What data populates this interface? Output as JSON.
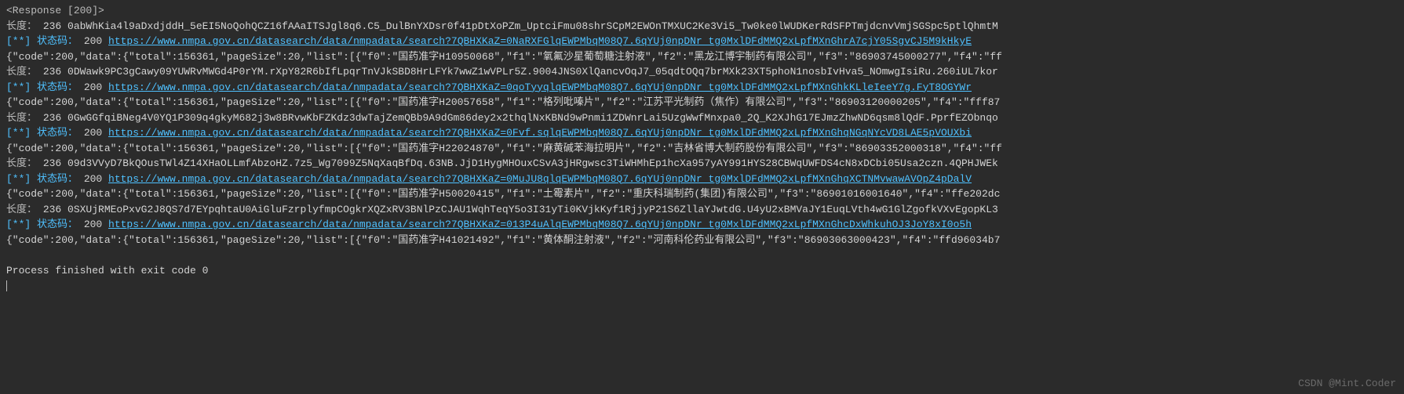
{
  "console": {
    "response_header": "<Response [200]>",
    "length_label": "长度：",
    "status_label": "[**] 状态码：",
    "status_code": "  200    ",
    "process_exit": "Process finished with exit code 0",
    "lines": [
      {
        "type": "length",
        "value": " 236 0abWhKia4l9aDxdjddH_5eEI5NoQohQCZ16fAAaITSJgl8q6.C5_DulBnYXDsr0f41pDtXoPZm_UptciFmu08shrSCpM2EWOnTMXUC2Ke3Vi5_Tw0ke0lWUDKerRdSFPTmjdcnvVmjSGSpc5ptlQhmtM"
      },
      {
        "type": "status",
        "url": "https://www.nmpa.gov.cn/datasearch/data/nmpadata/search?7QBHXKaZ=0NaRXFGlqEWPMbqM08Q7.6qYUj0npDNr_tg0MxlDFdMMQ2xLpfMXnGhrA7cjY05SgvCJ5M9kHkyE"
      },
      {
        "type": "json",
        "content": "{\"code\":200,\"data\":{\"total\":156361,\"pageSize\":20,\"list\":[{\"f0\":\"国药准字H10950068\",\"f1\":\"氧氟沙星葡萄糖注射液\",\"f2\":\"黑龙江博宇制药有限公司\",\"f3\":\"86903745000277\",\"f4\":\"ff"
      },
      {
        "type": "length",
        "value": " 236 0DWawk9PC3gCawy09YUWRvMWGd4P0rYM.rXpY82R6bIfLpqrTnVJkSBD8HrLFYk7wwZ1wVPLr5Z.9004JNS0XlQancvOqJ7_05qdtOQq7brMXk23XT5phoN1nosbIvHva5_NOmwgIsiRu.260iUL7kor"
      },
      {
        "type": "status",
        "url": "https://www.nmpa.gov.cn/datasearch/data/nmpadata/search?7QBHXKaZ=0qoTyyqlqEWPMbqM08Q7.6qYUj0npDNr_tg0MxlDFdMMQ2xLpfMXnGhkKLleIeeY7g.FyT8OGYWr"
      },
      {
        "type": "json",
        "content": "{\"code\":200,\"data\":{\"total\":156361,\"pageSize\":20,\"list\":[{\"f0\":\"国药准字H20057658\",\"f1\":\"格列吡嗪片\",\"f2\":\"江苏平光制药（焦作）有限公司\",\"f3\":\"86903120000205\",\"f4\":\"fff87"
      },
      {
        "type": "length",
        "value": " 236 0GwGGfqiBNeg4V0YQ1P309q4gkyM682j3w8BRvwKbFZKdz3dwTajZemQBb9A9dGm86dey2x2thqlNxKBNd9wPnmi1ZDWnrLai5UzgWwfMnxpa0_2Q_K2XJhG17EJmzZhwND6qsm8lQdF.PprfEZObnqo"
      },
      {
        "type": "status",
        "url": "https://www.nmpa.gov.cn/datasearch/data/nmpadata/search?7QBHXKaZ=0Fvf.sqlqEWPMbqM08Q7.6qYUj0npDNr_tg0MxlDFdMMQ2xLpfMXnGhqNGqNYcVD8LAE5pVOUXbi"
      },
      {
        "type": "json",
        "content": "{\"code\":200,\"data\":{\"total\":156361,\"pageSize\":20,\"list\":[{\"f0\":\"国药准字H22024870\",\"f1\":\"麻黄碱苯海拉明片\",\"f2\":\"吉林省博大制药股份有限公司\",\"f3\":\"86903352000318\",\"f4\":\"ff"
      },
      {
        "type": "length",
        "value": " 236 09d3VVyD7BkQOusTWl4Z14XHaOLLmfAbzoHZ.7z5_Wg7099Z5NqXaqBfDq.63NB.JjD1HygMHOuxCSvA3jHRgwsc3TiWHMhEp1hcXa957yAY991HYS28CBWqUWFDS4cN8xDCbi05Usa2czn.4QPHJWEk"
      },
      {
        "type": "status",
        "url": "https://www.nmpa.gov.cn/datasearch/data/nmpadata/search?7QBHXKaZ=0MuJU8qlqEWPMbqM08Q7.6qYUj0npDNr_tg0MxlDFdMMQ2xLpfMXnGhqXCTNMvwawAVOpZ4pDalV"
      },
      {
        "type": "json",
        "content": "{\"code\":200,\"data\":{\"total\":156361,\"pageSize\":20,\"list\":[{\"f0\":\"国药准字H50020415\",\"f1\":\"土霉素片\",\"f2\":\"重庆科瑞制药(集团)有限公司\",\"f3\":\"86901016001640\",\"f4\":\"ffe202dc"
      },
      {
        "type": "length",
        "value": " 236 0SXUjRMEoPxvG2J8QS7d7EYpqhtaU0AiGluFzrplyfmpCOgkrXQZxRV3BNlPzCJAU1WqhTeqY5o3I31yTi0KVjkKyf1RjjyP21S6ZllaYJwtdG.U4yU2xBMVaJY1EuqLVth4wG1GlZgofkVXvEgopKL3"
      },
      {
        "type": "status",
        "url": "https://www.nmpa.gov.cn/datasearch/data/nmpadata/search?7QBHXKaZ=013P4uAlqEWPMbqM08Q7.6qYUj0npDNr_tg0MxlDFdMMQ2xLpfMXnGhcDxWhkuhOJ3JoY8xI0o5h"
      },
      {
        "type": "json",
        "content": "{\"code\":200,\"data\":{\"total\":156361,\"pageSize\":20,\"list\":[{\"f0\":\"国药准字H41021492\",\"f1\":\"黄体酮注射液\",\"f2\":\"河南科伦药业有限公司\",\"f3\":\"86903063000423\",\"f4\":\"ffd96034b7"
      }
    ],
    "watermark": "CSDN @Mint.Coder"
  }
}
